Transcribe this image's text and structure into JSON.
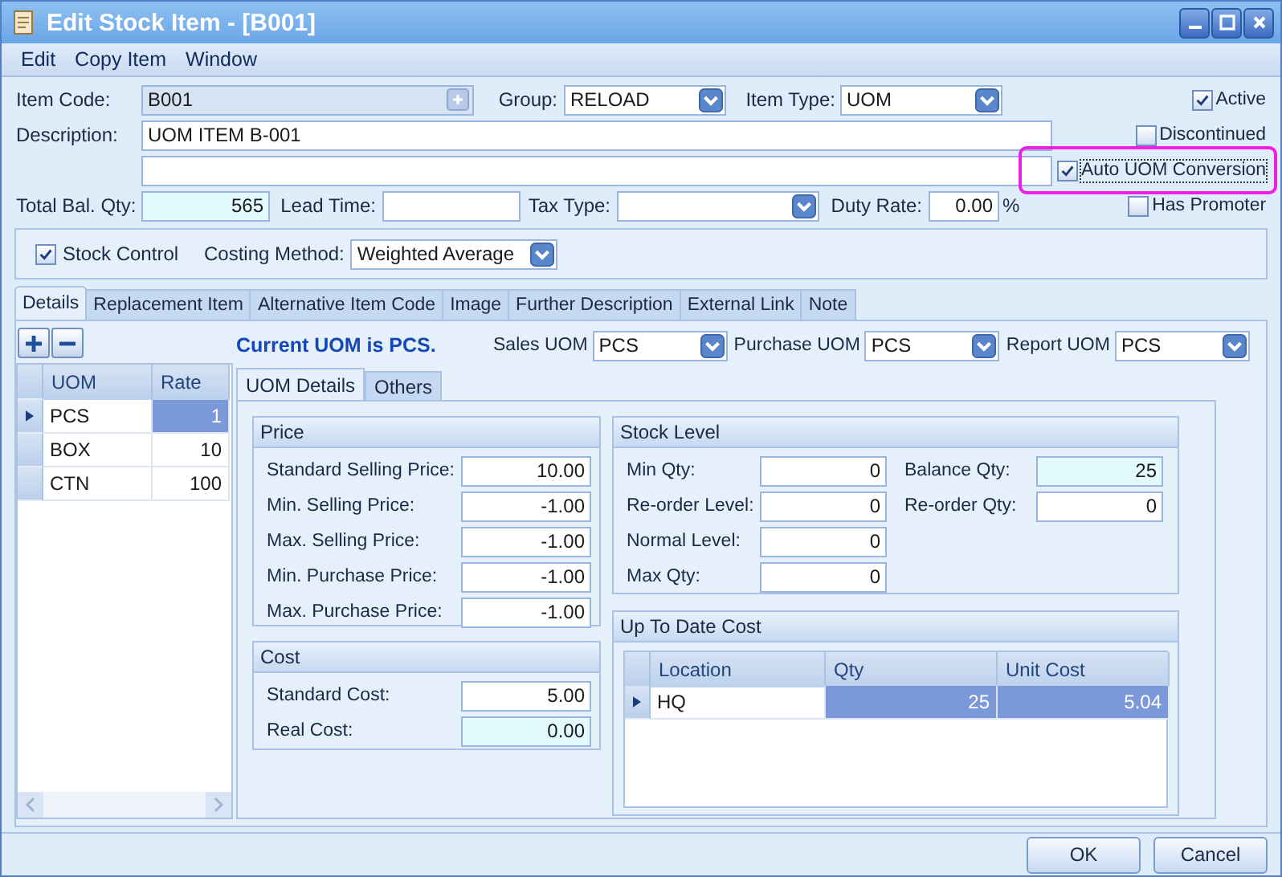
{
  "window": {
    "title": "Edit Stock Item - [B001]"
  },
  "menu": [
    {
      "label": "Edit"
    },
    {
      "label": "Copy Item"
    },
    {
      "label": "Window"
    }
  ],
  "header": {
    "item_code": {
      "label": "Item Code:",
      "value": "B001"
    },
    "group": {
      "label": "Group:",
      "value": "RELOAD"
    },
    "item_type": {
      "label": "Item Type:",
      "value": "UOM"
    },
    "description": {
      "label": "Description:",
      "value": "UOM ITEM B-001"
    },
    "total_bal_qty": {
      "label": "Total Bal. Qty:",
      "value": "565",
      "readonly": true
    },
    "lead_time": {
      "label": "Lead Time:"
    },
    "tax_type": {
      "label": "Tax Type:"
    },
    "duty_rate": {
      "label": "Duty Rate:",
      "value": "0.00",
      "unit": "%"
    }
  },
  "flags": [
    {
      "label": "Active",
      "checked": true,
      "highlighted": false
    },
    {
      "label": "Discontinued",
      "checked": false,
      "highlighted": false
    },
    {
      "label": "Auto UOM Conversion",
      "checked": true,
      "highlighted": true
    },
    {
      "label": "Has Promoter",
      "checked": false,
      "highlighted": false
    }
  ],
  "stock_control": {
    "label": "Stock Control",
    "checked": true
  },
  "costing_method": {
    "label": "Costing Method:",
    "value": "Weighted Average"
  },
  "tabs": [
    {
      "label": "Details",
      "selected": true
    },
    {
      "label": "Replacement Item",
      "selected": false
    },
    {
      "label": "Alternative Item Code",
      "selected": false
    },
    {
      "label": "Image",
      "selected": false
    },
    {
      "label": "Further Description",
      "selected": false
    },
    {
      "label": "External Link",
      "selected": false
    },
    {
      "label": "Note",
      "selected": false
    }
  ],
  "uom_grid": {
    "columns": [
      "UOM",
      "Rate"
    ],
    "rows": [
      {
        "uom": "PCS",
        "rate": "1",
        "selected": true
      },
      {
        "uom": "BOX",
        "rate": "10",
        "selected": false
      },
      {
        "uom": "CTN",
        "rate": "100",
        "selected": false
      }
    ]
  },
  "current_uom": "Current UOM is PCS.",
  "uom_selects": [
    {
      "label": "Sales UOM",
      "value": "PCS"
    },
    {
      "label": "Purchase UOM",
      "value": "PCS"
    },
    {
      "label": "Report UOM",
      "value": "PCS"
    }
  ],
  "sub_tabs": [
    {
      "label": "UOM Details",
      "selected": true
    },
    {
      "label": "Others",
      "selected": false
    }
  ],
  "price": {
    "title": "Price",
    "fields": [
      {
        "label": "Standard Selling Price:",
        "value": "10.00"
      },
      {
        "label": "Min. Selling Price:",
        "value": "-1.00"
      },
      {
        "label": "Max. Selling Price:",
        "value": "-1.00"
      },
      {
        "label": "Min. Purchase Price:",
        "value": "-1.00"
      },
      {
        "label": "Max. Purchase Price:",
        "value": "-1.00"
      }
    ]
  },
  "stock_level": {
    "title": "Stock Level",
    "left": [
      {
        "label": "Min Qty:",
        "value": "0"
      },
      {
        "label": "Re-order Level:",
        "value": "0"
      },
      {
        "label": "Normal Level:",
        "value": "0"
      },
      {
        "label": "Max Qty:",
        "value": "0"
      }
    ],
    "right": [
      {
        "label": "Balance Qty:",
        "value": "25",
        "readonly": true
      },
      {
        "label": "Re-order Qty:",
        "value": "0"
      }
    ]
  },
  "cost": {
    "title": "Cost",
    "fields": [
      {
        "label": "Standard Cost:",
        "value": "5.00"
      },
      {
        "label": "Real Cost:",
        "value": "0.00",
        "readonly": true
      }
    ]
  },
  "up_to_date_cost": {
    "title": "Up To Date Cost",
    "columns": [
      "Location",
      "Qty",
      "Unit Cost"
    ],
    "rows": [
      {
        "cells": [
          "HQ",
          "25",
          "5.04"
        ],
        "selected": true
      }
    ]
  },
  "buttons": [
    {
      "label": "OK"
    },
    {
      "label": "Cancel"
    }
  ]
}
